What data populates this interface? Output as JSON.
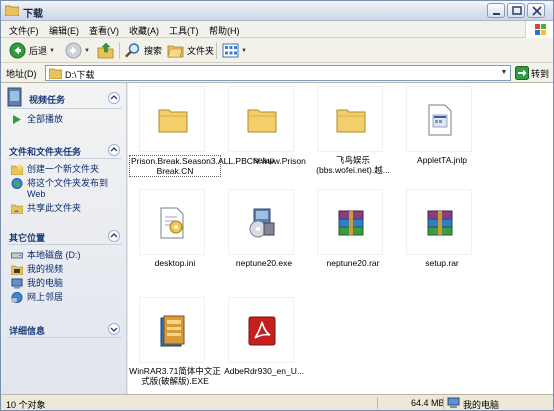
{
  "window": {
    "title": "下载"
  },
  "menu": [
    "文件(F)",
    "编辑(E)",
    "查看(V)",
    "收藏(A)",
    "工具(T)",
    "帮助(H)"
  ],
  "toolbar": {
    "back": "后退",
    "search": "搜索",
    "folders": "文件夹"
  },
  "address": {
    "label": "地址(D)",
    "value": "D:\\下载",
    "go": "转到"
  },
  "sidebar": {
    "video": {
      "title": "视频任务",
      "items": [
        "全部播放"
      ]
    },
    "file_tasks": {
      "title": "文件和文件夹任务",
      "items": [
        "创建一个新文件夹",
        "将这个文件夹发布到 Web",
        "共享此文件夹"
      ]
    },
    "other": {
      "title": "其它位置",
      "items": [
        "本地磁盘 (D:)",
        "我的视频",
        "我的电脑",
        "网上邻居"
      ]
    },
    "details": {
      "title": "详细信息"
    }
  },
  "files": [
    {
      "name": "Prison.Break.Season3.ALL.PBCN.www.Prison Break.CN",
      "icon": "folder-icon"
    },
    {
      "name": "setup",
      "icon": "folder-icon"
    },
    {
      "name": "飞鸟娱乐 (bbs.wofei.net).越...",
      "icon": "folder-icon"
    },
    {
      "name": "AppletTA.jnlp",
      "icon": "jnlp-file-icon"
    },
    {
      "name": "desktop.ini",
      "icon": "ini-file-icon"
    },
    {
      "name": "neptune20.exe",
      "icon": "installer-icon"
    },
    {
      "name": "neptune20.rar",
      "icon": "rar-archive-icon"
    },
    {
      "name": "setup.rar",
      "icon": "rar-archive-icon"
    },
    {
      "name": "WinRAR3.71简体中文正式版(破解版).EXE",
      "icon": "winrar-exe-icon"
    },
    {
      "name": "AdbeRdr930_en_U...",
      "icon": "pdf-installer-icon"
    }
  ],
  "status": {
    "objects": "10 个对象",
    "size": "64.4 MB",
    "location": "我的电脑"
  }
}
